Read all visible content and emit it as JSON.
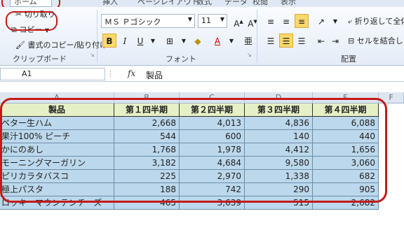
{
  "ribbon": {
    "tabs": [
      "ホーム",
      "挿入",
      "ページレイアウト",
      "数式",
      "データ",
      "校閲",
      "表示"
    ],
    "clipboard": {
      "cut_label": "切り取り",
      "copy_label": "コピー",
      "format_painter_label": "書式のコピー/貼り付け",
      "group_label": "クリップボード"
    },
    "font": {
      "font_name": "ＭＳ Ｐゴシック",
      "font_size": "11",
      "group_label": "フォント"
    },
    "alignment": {
      "wrap_text_label": "折り返して全体",
      "merge_label": "セルを結合し",
      "group_label": "配置"
    }
  },
  "formula_bar": {
    "name_box": "A1",
    "fx": "fx",
    "content": "製品"
  },
  "columns": [
    "A",
    "B",
    "C",
    "D",
    "E",
    "F"
  ],
  "table": {
    "headers": [
      "製品",
      "第１四半期",
      "第２四半期",
      "第３四半期",
      "第４四半期"
    ],
    "rows": [
      {
        "name": "ベター生ハム",
        "q1": "2,668",
        "q2": "4,013",
        "q3": "4,836",
        "q4": "6,088"
      },
      {
        "name": "果汁100% ピーチ",
        "q1": "544",
        "q2": "600",
        "q3": "140",
        "q4": "440"
      },
      {
        "name": "かにのあし",
        "q1": "1,768",
        "q2": "1,978",
        "q3": "4,412",
        "q4": "1,656"
      },
      {
        "name": "モーニングマーガリン",
        "q1": "3,182",
        "q2": "4,684",
        "q3": "9,580",
        "q4": "3,060"
      },
      {
        "name": "ピリカラタバスコ",
        "q1": "225",
        "q2": "2,970",
        "q3": "1,338",
        "q4": "682"
      },
      {
        "name": "極上パスタ",
        "q1": "188",
        "q2": "742",
        "q3": "290",
        "q4": "905"
      },
      {
        "name": "ロッキーマウンテンチーズ",
        "q1": "465",
        "q2": "3,639",
        "q3": "515",
        "q4": "2,682"
      }
    ]
  }
}
